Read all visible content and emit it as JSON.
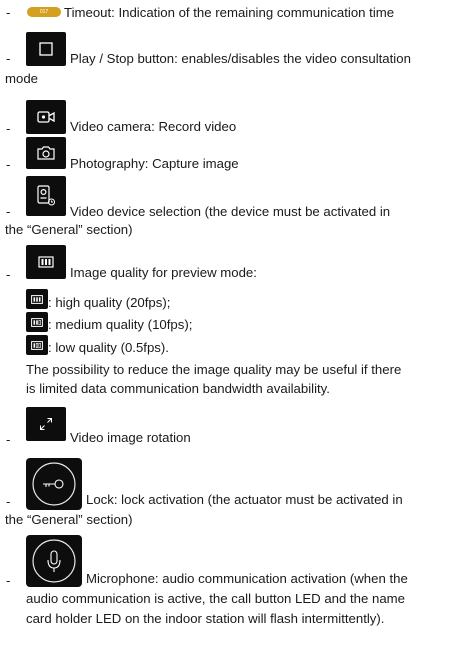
{
  "dash": "-",
  "items": {
    "timeout": {
      "badge_text": "017",
      "label": "Timeout: Indication of the remaining communication time",
      "icon": "timeout-badge-icon"
    },
    "play_stop": {
      "label_line1": "Play / Stop button: enables/disables the video consultation",
      "label_line2": "mode",
      "icon": "square-stop-icon"
    },
    "camera": {
      "label": "Video camera: Record video",
      "icon": "video-camera-icon"
    },
    "photo": {
      "label": "Photography: Capture image",
      "icon": "photo-camera-icon"
    },
    "device": {
      "label_line1": "Video device selection (the device must be activated in",
      "label_line2": "the “General” section)",
      "icon": "device-selection-icon"
    },
    "quality": {
      "label": "Image quality for preview mode:",
      "icon": "image-quality-icon",
      "options": [
        {
          "text": ": high quality (20fps);",
          "icon": "quality-high-icon"
        },
        {
          "text": ": medium quality (10fps);",
          "icon": "quality-medium-icon"
        },
        {
          "text": ": low quality (0.5fps).",
          "icon": "quality-low-icon"
        }
      ],
      "note_line1": "The possibility to reduce the image quality may be useful if there",
      "note_line2": "is limited data communication bandwidth availability."
    },
    "rotation": {
      "label": "Video image rotation",
      "icon": "expand-arrows-icon"
    },
    "lock": {
      "label_line1": "Lock: lock activation (the actuator must be activated in",
      "label_line2": "the “General” section)",
      "icon": "key-lock-icon"
    },
    "microphone": {
      "label_line1": "Microphone: audio communication activation (when the",
      "label_line2": "audio communication is active, the call button LED and the name",
      "label_line3": "card holder LED on the indoor station will flash intermittently).",
      "icon": "microphone-icon"
    }
  }
}
